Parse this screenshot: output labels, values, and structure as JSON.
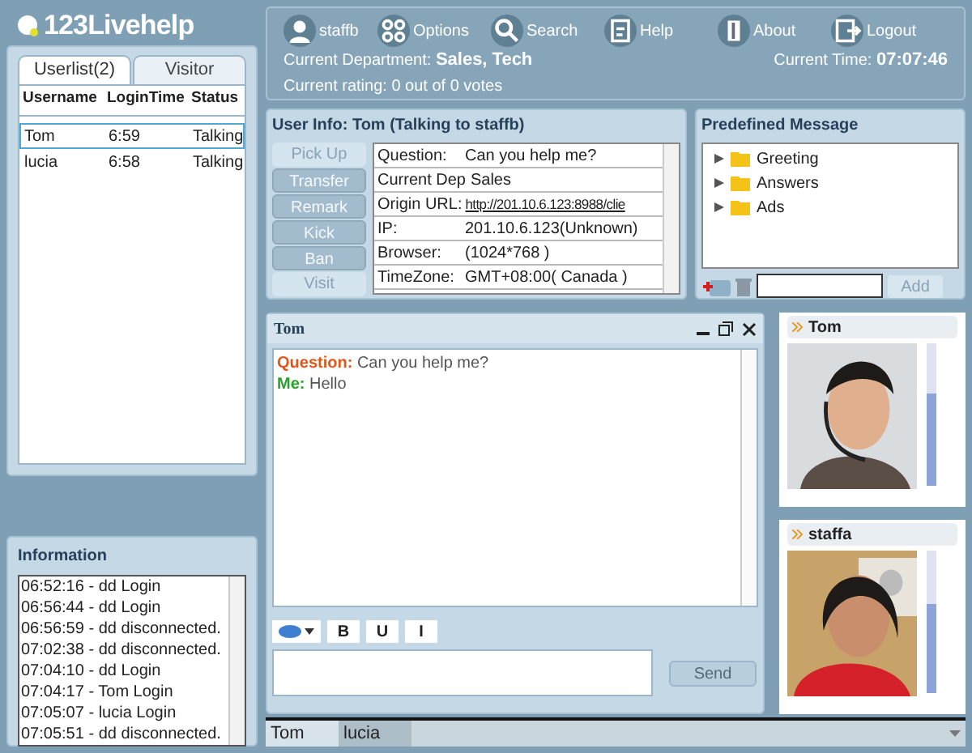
{
  "app": {
    "logo": "123Livehelp"
  },
  "userlist": {
    "tabs": [
      {
        "label": "Userlist(2)",
        "selected": true
      },
      {
        "label": "Visitor",
        "selected": false
      }
    ],
    "columns": [
      "Username",
      "LoginTime",
      "Status"
    ],
    "rows": [
      {
        "cells": [
          "Tom",
          "6:59",
          "Talking"
        ],
        "selected": true
      },
      {
        "cells": [
          "lucia",
          "6:58",
          "Talking"
        ],
        "selected": false
      }
    ]
  },
  "information": {
    "title": "Information",
    "lines": [
      "06:52:16 - dd Login",
      "06:56:44 - dd Login",
      "06:56:59 - dd disconnected.",
      "07:02:38 - dd disconnected.",
      "07:04:10 - dd Login",
      "07:04:17 - Tom Login",
      "07:05:07 - lucia Login",
      "07:05:51 - dd disconnected."
    ]
  },
  "toolbar": {
    "items": [
      "staffb",
      "Options",
      "Search",
      "Help",
      "About",
      "Logout"
    ],
    "department_label": "Current Department:",
    "department": "Sales, Tech",
    "rating": "Current rating: 0 out of 0 votes",
    "time_label": "Current Time:",
    "time": "07:07:46"
  },
  "user_info": {
    "title": "User Info: Tom (Talking to staffb)",
    "actions": [
      {
        "label": "Pick Up",
        "disabled": true
      },
      {
        "label": "Transfer",
        "disabled": false
      },
      {
        "label": "Remark",
        "disabled": false
      },
      {
        "label": "Kick",
        "disabled": false
      },
      {
        "label": "Ban",
        "disabled": false
      },
      {
        "label": "Visit",
        "disabled": true
      }
    ],
    "fields": [
      {
        "label": "Question:",
        "value": "Can you help me?",
        "kind": "text"
      },
      {
        "label": "Current Dep",
        "value": "Sales",
        "kind": "text"
      },
      {
        "label": "Origin URL:",
        "value": "http://201.10.6.123:8988/clie",
        "kind": "link"
      },
      {
        "label": "IP:",
        "value": "201.10.6.123(Unknown)",
        "kind": "text"
      },
      {
        "label": "Browser:",
        "value": "(1024*768 )",
        "kind": "text"
      },
      {
        "label": "TimeZone:",
        "value": "GMT+08:00( Canada )",
        "kind": "text"
      }
    ]
  },
  "predefined": {
    "title": "Predefined Message",
    "folders": [
      {
        "label": "Greeting",
        "expanded": false
      },
      {
        "label": "Answers",
        "expanded": false
      },
      {
        "label": "Ads",
        "expanded": false
      }
    ],
    "add": {
      "label": "Add",
      "disabled": true
    }
  },
  "chat": {
    "title": "Tom",
    "messages": [
      {
        "speaker": "Question:",
        "text": "Can you help me?",
        "kind": "visitor"
      },
      {
        "speaker": "Me:",
        "text": "Hello",
        "kind": "agent"
      }
    ],
    "format_buttons": [
      "B",
      "U",
      "I"
    ],
    "send": "Send"
  },
  "videos": [
    {
      "name": "Tom",
      "level": 0.65,
      "kind": "man"
    },
    {
      "name": "staffa",
      "level": 0.63,
      "kind": "woman"
    }
  ],
  "taskbar": {
    "tabs": [
      {
        "label": "Tom",
        "selected": true
      },
      {
        "label": "lucia",
        "selected": false
      }
    ]
  }
}
